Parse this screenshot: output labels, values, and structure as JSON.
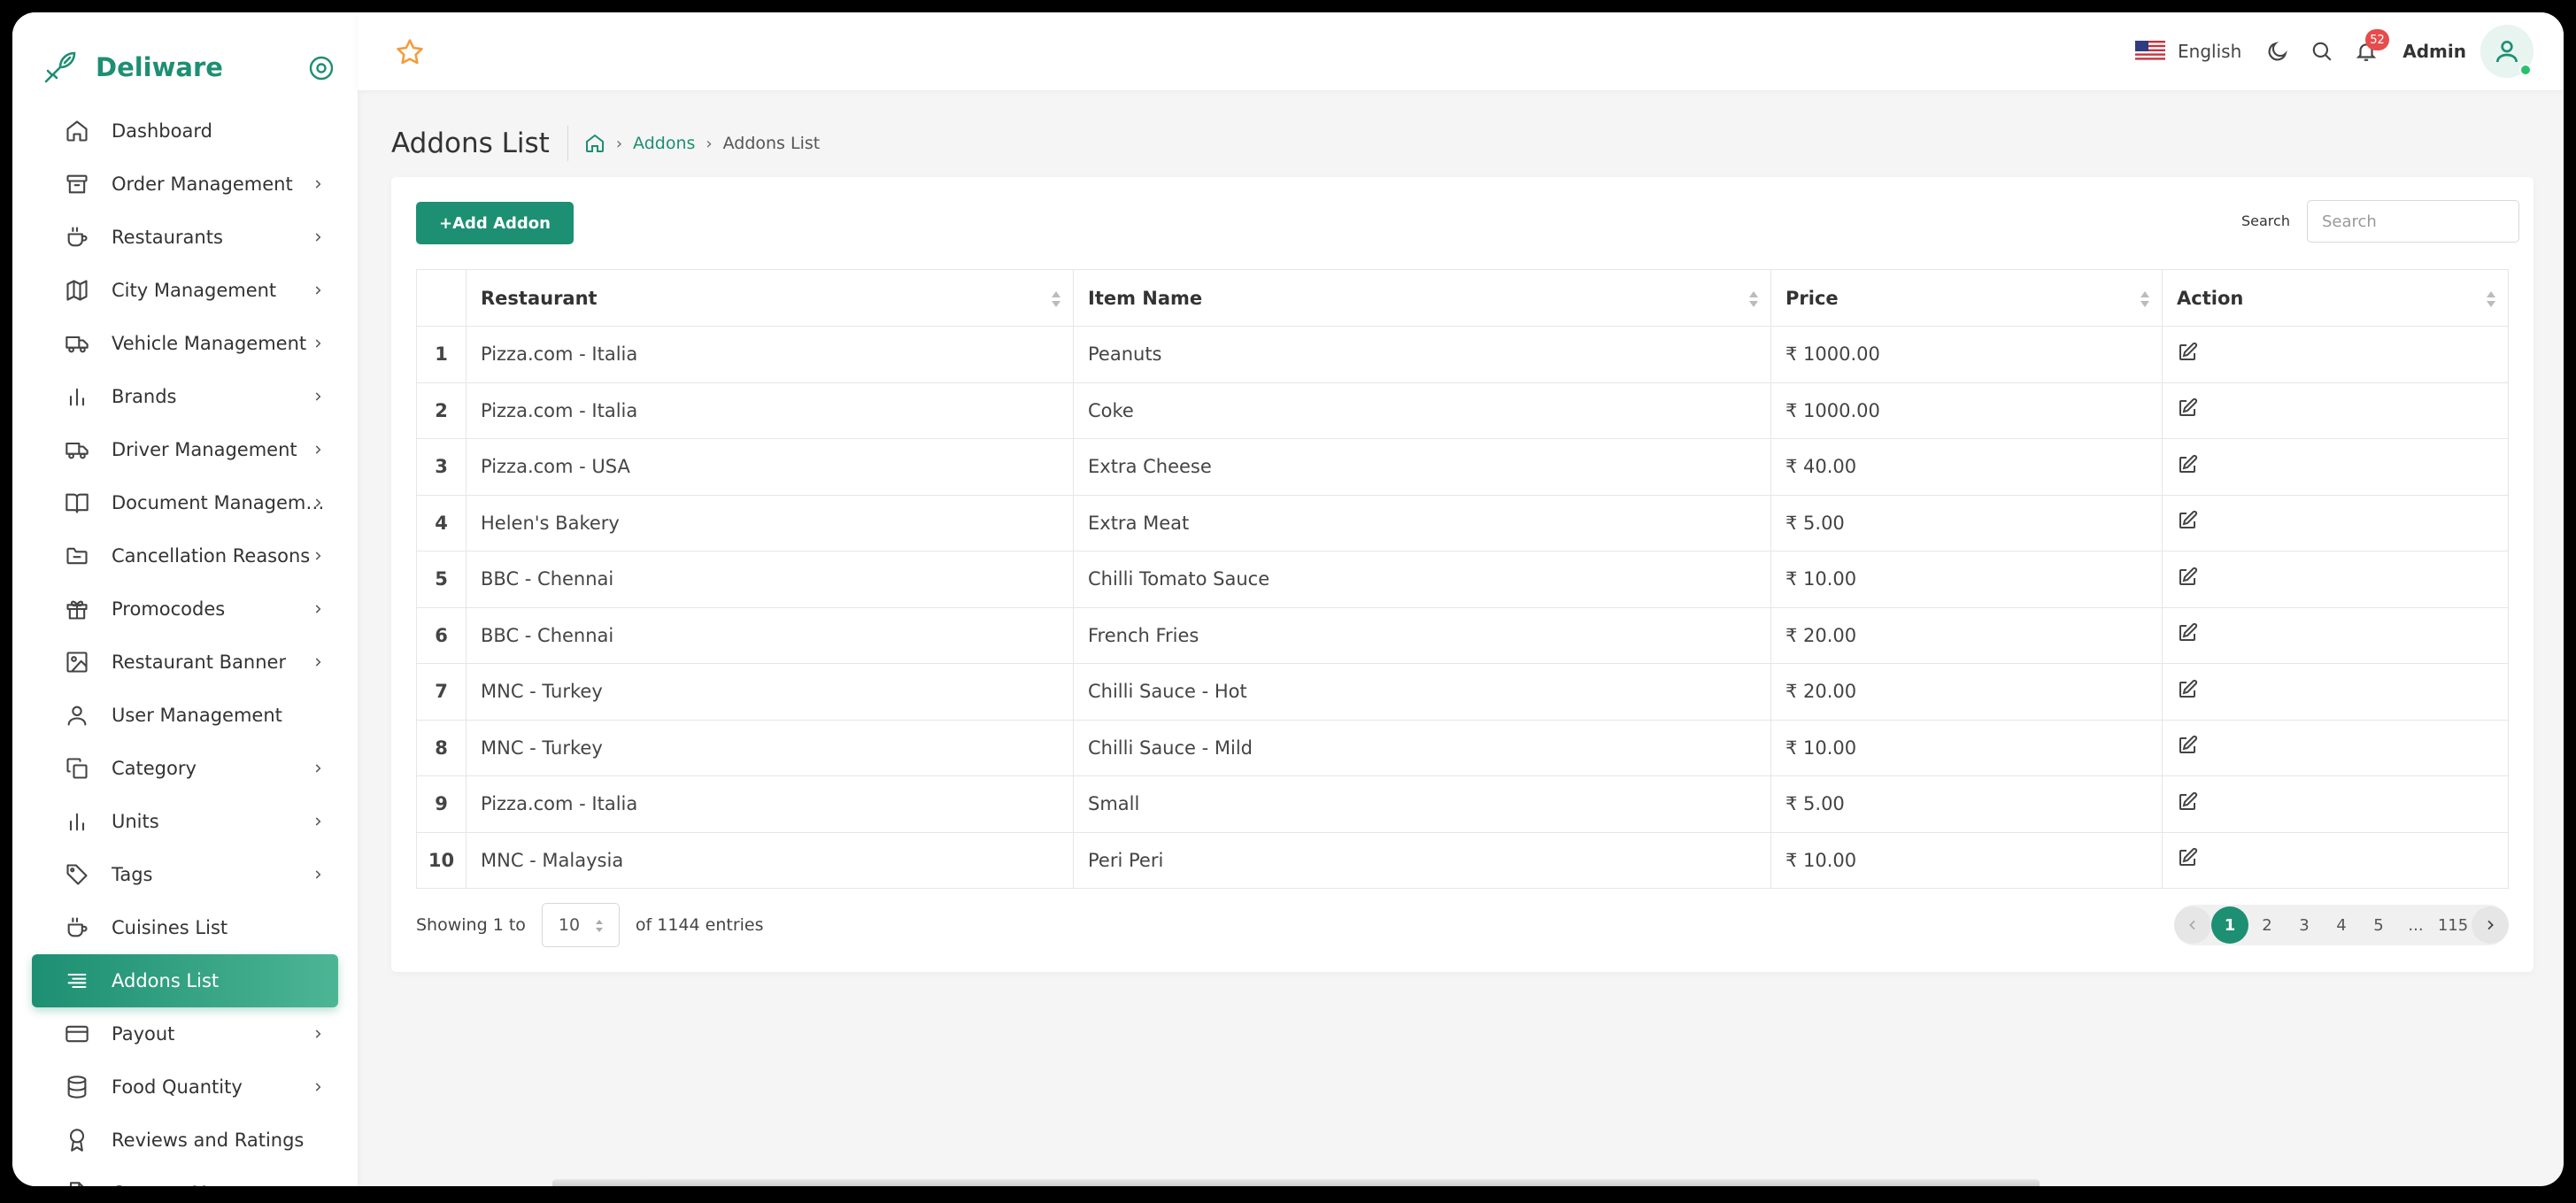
{
  "brand": {
    "name": "Deliware"
  },
  "sidebar": {
    "items": [
      {
        "label": "Dashboard",
        "icon": "home-icon",
        "chevron": false
      },
      {
        "label": "Order Management",
        "icon": "archive-icon",
        "chevron": true
      },
      {
        "label": "Restaurants",
        "icon": "coffee-icon",
        "chevron": true
      },
      {
        "label": "City Management",
        "icon": "map-icon",
        "chevron": true
      },
      {
        "label": "Vehicle Management",
        "icon": "truck-icon",
        "chevron": true
      },
      {
        "label": "Brands",
        "icon": "bar-chart-icon",
        "chevron": true
      },
      {
        "label": "Driver Management",
        "icon": "truck-icon",
        "chevron": true
      },
      {
        "label": "Document Manageme...",
        "icon": "book-icon",
        "chevron": true
      },
      {
        "label": "Cancellation Reasons",
        "icon": "folder-icon",
        "chevron": true
      },
      {
        "label": "Promocodes",
        "icon": "gift-icon",
        "chevron": true
      },
      {
        "label": "Restaurant Banner",
        "icon": "image-icon",
        "chevron": true
      },
      {
        "label": "User Management",
        "icon": "user-icon",
        "chevron": false
      },
      {
        "label": "Category",
        "icon": "copy-icon",
        "chevron": true
      },
      {
        "label": "Units",
        "icon": "bar-chart-icon",
        "chevron": true
      },
      {
        "label": "Tags",
        "icon": "tag-icon",
        "chevron": true
      },
      {
        "label": "Cuisines List",
        "icon": "coffee-icon",
        "chevron": false
      },
      {
        "label": "Addons List",
        "icon": "list-icon",
        "chevron": false,
        "active": true
      },
      {
        "label": "Payout",
        "icon": "credit-card-icon",
        "chevron": true
      },
      {
        "label": "Food Quantity",
        "icon": "database-icon",
        "chevron": true
      },
      {
        "label": "Reviews and Ratings",
        "icon": "award-icon",
        "chevron": false
      },
      {
        "label": "Content Management",
        "icon": "file-icon",
        "chevron": true
      }
    ]
  },
  "topbar": {
    "language": "English",
    "notification_count": "52",
    "user_name": "Admin"
  },
  "page": {
    "title": "Addons List",
    "breadcrumb": {
      "parent": "Addons",
      "current": "Addons List"
    }
  },
  "toolbar": {
    "add_label": "+Add Addon",
    "search_label": "Search",
    "search_placeholder": "Search"
  },
  "table": {
    "columns": [
      "Restaurant",
      "Item Name",
      "Price",
      "Action"
    ],
    "rows": [
      {
        "no": "1",
        "restaurant": "Pizza.com - Italia",
        "item": "Peanuts",
        "price": "₹ 1000.00"
      },
      {
        "no": "2",
        "restaurant": "Pizza.com - Italia",
        "item": "Coke",
        "price": "₹ 1000.00"
      },
      {
        "no": "3",
        "restaurant": "Pizza.com - USA",
        "item": "Extra Cheese",
        "price": "₹ 40.00"
      },
      {
        "no": "4",
        "restaurant": "Helen's Bakery",
        "item": "Extra Meat",
        "price": "₹ 5.00"
      },
      {
        "no": "5",
        "restaurant": "BBC - Chennai",
        "item": "Chilli Tomato Sauce",
        "price": "₹ 10.00"
      },
      {
        "no": "6",
        "restaurant": "BBC - Chennai",
        "item": "French Fries",
        "price": "₹ 20.00"
      },
      {
        "no": "7",
        "restaurant": "MNC - Turkey",
        "item": "Chilli Sauce - Hot",
        "price": "₹ 20.00"
      },
      {
        "no": "8",
        "restaurant": "MNC - Turkey",
        "item": "Chilli Sauce - Mild",
        "price": "₹ 10.00"
      },
      {
        "no": "9",
        "restaurant": "Pizza.com - Italia",
        "item": "Small",
        "price": "₹ 5.00"
      },
      {
        "no": "10",
        "restaurant": "MNC - Malaysia",
        "item": "Peri Peri",
        "price": "₹ 10.00"
      }
    ]
  },
  "footer": {
    "showing_prefix": "Showing 1 to",
    "page_size": "10",
    "entries_suffix": "of 1144 entries",
    "pages": [
      "1",
      "2",
      "3",
      "4",
      "5",
      "...",
      "115"
    ],
    "current_page": "1"
  },
  "colors": {
    "accent": "#1d8f72",
    "badge": "#e74c4c",
    "star": "#f39c3d"
  }
}
